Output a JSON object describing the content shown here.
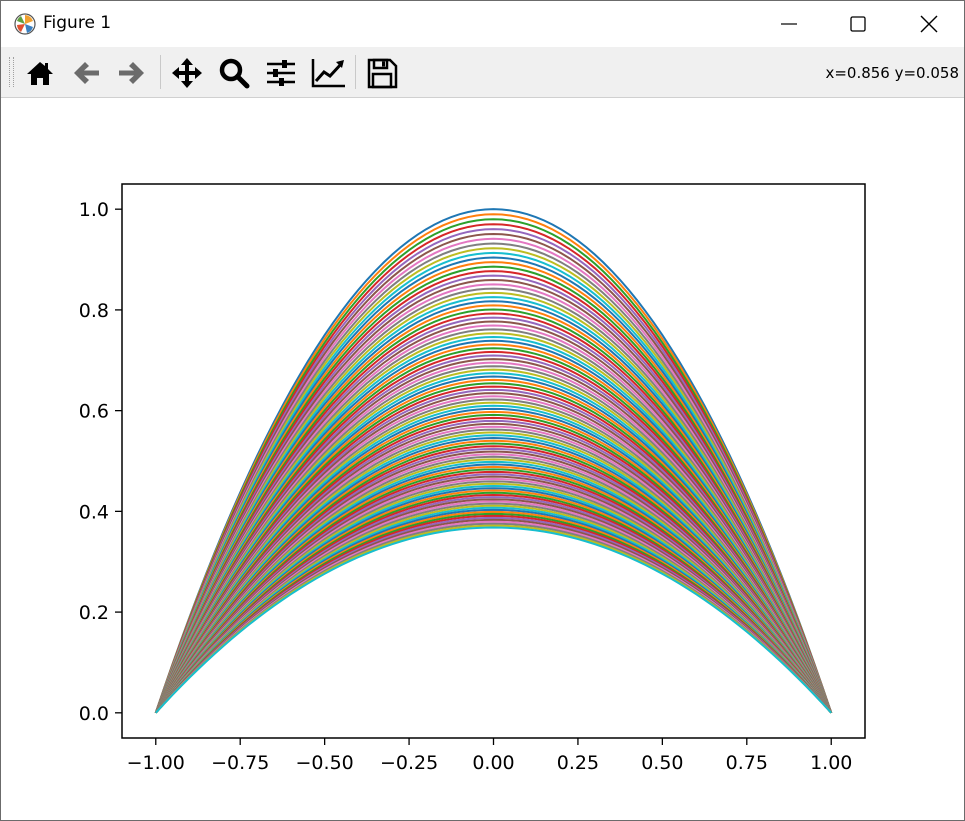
{
  "window": {
    "title": "Figure 1",
    "controls": {
      "minimize": "minimize-icon",
      "maximize": "maximize-icon",
      "close": "close-icon"
    }
  },
  "toolbar": {
    "buttons": [
      {
        "name": "home-button",
        "icon": "home-icon"
      },
      {
        "name": "back-button",
        "icon": "arrow-left-icon"
      },
      {
        "name": "forward-button",
        "icon": "arrow-right-icon"
      },
      {
        "name": "pan-button",
        "icon": "move-icon"
      },
      {
        "name": "zoom-button",
        "icon": "magnifier-icon"
      },
      {
        "name": "subplots-button",
        "icon": "sliders-icon"
      },
      {
        "name": "customize-button",
        "icon": "line-chart-icon"
      },
      {
        "name": "save-button",
        "icon": "floppy-icon"
      }
    ],
    "coordinates": "x=0.856 y=0.058"
  },
  "chart_data": {
    "type": "line",
    "title": "",
    "xlabel": "",
    "ylabel": "",
    "xlim": [
      -1.1,
      1.1
    ],
    "ylim": [
      -0.05,
      1.05
    ],
    "xticks": [
      "−1.00",
      "−0.75",
      "−0.50",
      "−0.25",
      "0.00",
      "0.25",
      "0.50",
      "0.75",
      "1.00"
    ],
    "yticks": [
      "0.0",
      "0.2",
      "0.4",
      "0.6",
      "0.8",
      "1.0"
    ],
    "xtick_values": [
      -1.0,
      -0.75,
      -0.5,
      -0.25,
      0.0,
      0.25,
      0.5,
      0.75,
      1.0
    ],
    "ytick_values": [
      0.0,
      0.2,
      0.4,
      0.6,
      0.8,
      1.0
    ],
    "grid": false,
    "legend": false,
    "series_family": {
      "description_formula": "y = exp(-t) * (1 - x^2), x in [-1, 1]",
      "t_start": 0.0,
      "t_end": 1.0,
      "count": 100,
      "peak_max": 1.0,
      "peak_min": 0.368
    },
    "colors": [
      "#1f77b4",
      "#ff7f0e",
      "#2ca02c",
      "#d62728",
      "#9467bd",
      "#8c564b",
      "#e377c2",
      "#7f7f7f",
      "#bcbd22",
      "#17becf"
    ]
  }
}
